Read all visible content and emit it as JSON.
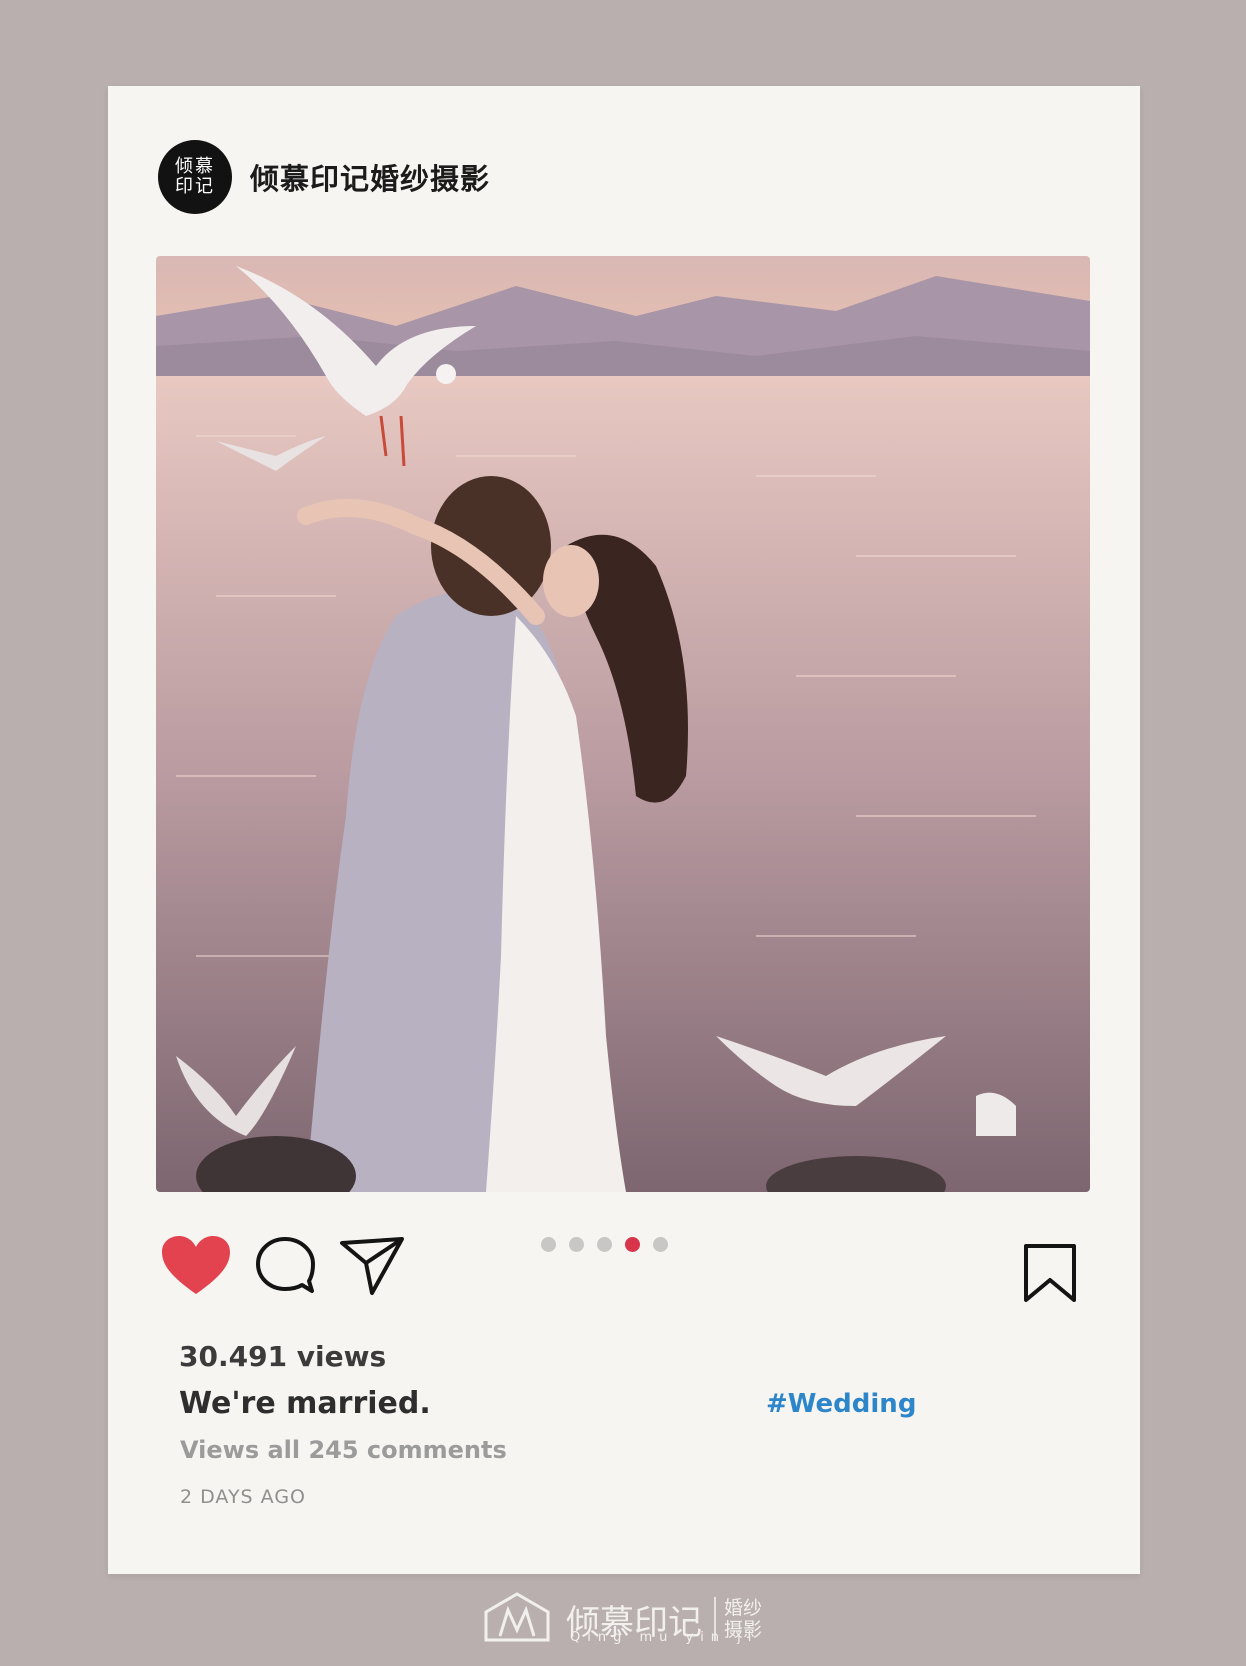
{
  "post": {
    "account_name": "倾慕印记婚纱摄影",
    "avatar_text": "倾慕印记",
    "views": "30.491 views",
    "caption": "We're married.",
    "hashtag": "#Wedding",
    "comments_link": "Views all 245 comments",
    "time_ago": "2 DAYS AGO",
    "carousel": {
      "count": 5,
      "active_index": 4
    },
    "liked": true
  },
  "footer": {
    "brand": "倾慕印记",
    "pinyin": "Qing mu yin ji",
    "tag": "婚纱摄影"
  },
  "colors": {
    "background": "#b9afae",
    "card": "#f7f5f2",
    "heart": "#e2434f",
    "hashtag": "#2d86c9",
    "active_dot": "#d8344a"
  },
  "icons": [
    "heart-icon",
    "comment-icon",
    "send-icon",
    "bookmark-icon"
  ]
}
